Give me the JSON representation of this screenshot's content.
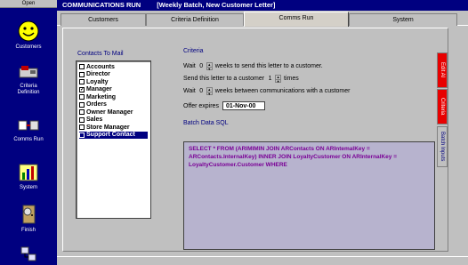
{
  "sidebar": {
    "top_label": "Open",
    "items": [
      {
        "label": "Customers",
        "icon": "smiley-face-icon"
      },
      {
        "label": "Criteria Definition",
        "icon": "cartridge-icon"
      },
      {
        "label": "Comms Run",
        "icon": "transfer-icon"
      },
      {
        "label": "System",
        "icon": "chart-icon"
      },
      {
        "label": "Finish",
        "icon": "door-icon"
      },
      {
        "label": "",
        "icon": "network-icon"
      }
    ]
  },
  "window": {
    "title": "COMMUNICATIONS RUN",
    "subtitle": "[Weekly Batch, New Customer Letter]"
  },
  "tabs": [
    {
      "label": "Customers",
      "active": false
    },
    {
      "label": "Criteria Definition",
      "active": false
    },
    {
      "label": "Comms Run",
      "active": true
    },
    {
      "label": "System",
      "active": false
    }
  ],
  "contacts": {
    "title": "Contacts To Mail",
    "items": [
      {
        "label": "Accounts",
        "checked": false,
        "selected": false
      },
      {
        "label": "Director",
        "checked": false,
        "selected": false
      },
      {
        "label": "Loyalty",
        "checked": false,
        "selected": false
      },
      {
        "label": "Manager",
        "checked": true,
        "selected": false
      },
      {
        "label": "Marketing",
        "checked": false,
        "selected": false
      },
      {
        "label": "Orders",
        "checked": false,
        "selected": false
      },
      {
        "label": "Owner Manager",
        "checked": false,
        "selected": false
      },
      {
        "label": "Sales",
        "checked": false,
        "selected": false
      },
      {
        "label": "Store Manager",
        "checked": false,
        "selected": false
      },
      {
        "label": "Support Contact",
        "checked": false,
        "selected": true
      }
    ]
  },
  "criteria": {
    "title": "Criteria",
    "wait_send_prefix": "Wait",
    "wait_send_value": "0",
    "wait_send_suffix": "weeks to send this letter to a customer.",
    "send_prefix": "Send this letter to a customer",
    "send_value": "1",
    "send_suffix": "times",
    "wait_between_prefix": "Wait",
    "wait_between_value": "0",
    "wait_between_suffix": "weeks between communications with a customer",
    "offer_label": "Offer expires",
    "offer_value": "01-Nov-00",
    "sql_label": "Batch Data SQL",
    "sql_text": "SELECT * FROM (ARIMIMIN JOIN ARContacts ON ARIntemalKey = ARContacts.InternalKey) INNER JOIN LoyaltyCustomer ON ARInternalKey = LoyaltyCustomer.Customer WHERE"
  },
  "vertical_tabs": [
    {
      "label": "Edit Al",
      "color": "red"
    },
    {
      "label": "Criteria",
      "color": "red"
    },
    {
      "label": "Batch Inputs",
      "color": "grey"
    }
  ]
}
